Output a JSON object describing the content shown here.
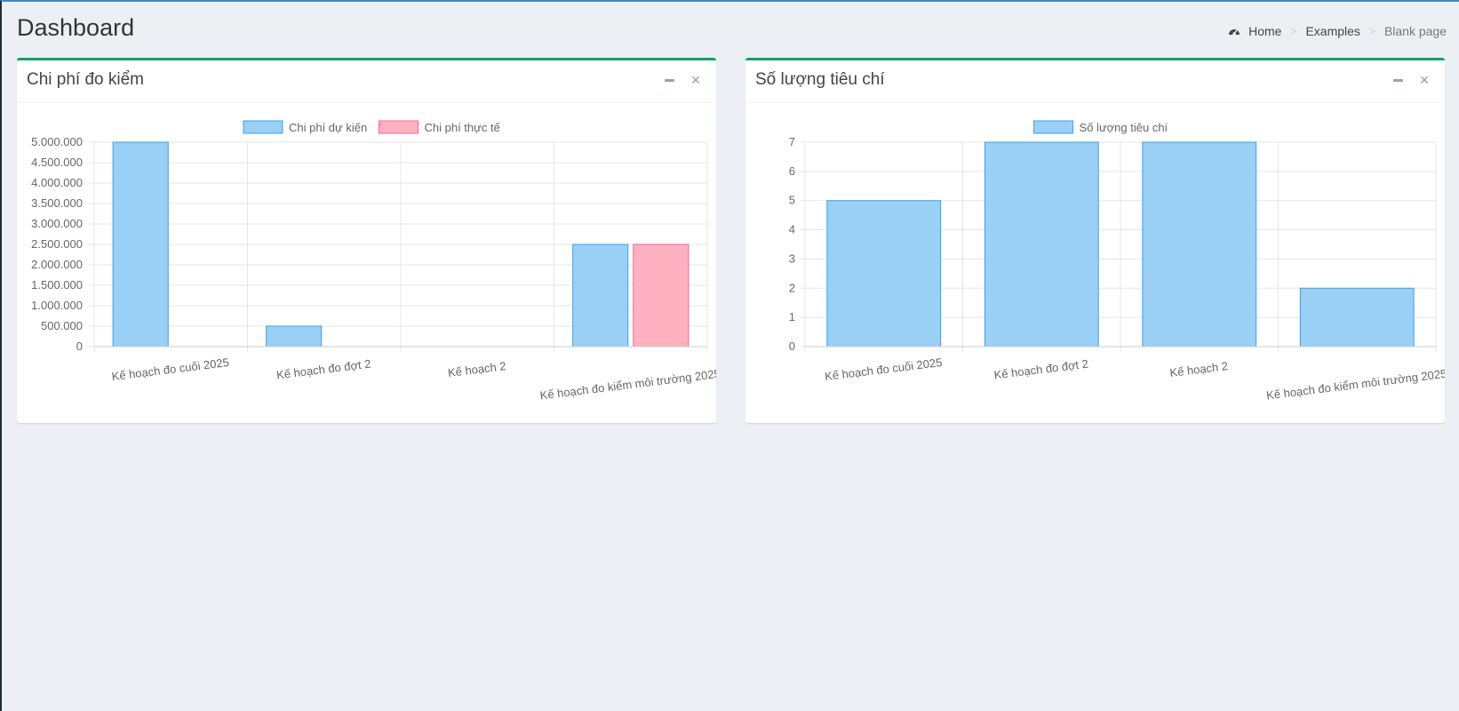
{
  "header": {
    "title": "Dashboard",
    "breadcrumb": [
      {
        "label": "Home",
        "icon": "dashboard-icon"
      },
      {
        "label": "Examples"
      },
      {
        "label": "Blank page"
      }
    ],
    "separator": ">"
  },
  "boxes": [
    {
      "title": "Chi phí đo kiểm",
      "accent": "#00a65a"
    },
    {
      "title": "Số lượng tiêu chí",
      "accent": "#00a65a"
    }
  ],
  "chart_data": [
    {
      "type": "bar",
      "title": "",
      "categories": [
        "Kế hoạch đo cuối 2025",
        "Kế hoạch đo đợt 2",
        "Kế hoạch 2",
        "Kế hoạch đo kiểm môi trường 2025"
      ],
      "series": [
        {
          "name": "Chi phí dự kiến",
          "values": [
            5000000,
            500000,
            0,
            2500000
          ],
          "fill": "#9ad0f5",
          "stroke": "#36a2eb"
        },
        {
          "name": "Chi phí thực tế",
          "values": [
            0,
            0,
            0,
            2500000
          ],
          "fill": "#ffb1c1",
          "stroke": "#ff6384"
        }
      ],
      "ylim": [
        0,
        5000000
      ],
      "yticks": [
        "0",
        "500.000",
        "1.000.000",
        "1.500.000",
        "2.000.000",
        "2.500.000",
        "3.000.000",
        "3.500.000",
        "4.000.000",
        "4.500.000",
        "5.000.000"
      ],
      "legend": "top",
      "grid": true
    },
    {
      "type": "bar",
      "title": "",
      "categories": [
        "Kế hoạch đo cuối 2025",
        "Kế hoạch đo đợt 2",
        "Kế hoạch 2",
        "Kế hoạch đo kiểm môi trường 2025"
      ],
      "series": [
        {
          "name": "Số lượng tiêu chí",
          "values": [
            5,
            7,
            7,
            2
          ],
          "fill": "#9ad0f5",
          "stroke": "#36a2eb"
        }
      ],
      "ylim": [
        0,
        7
      ],
      "yticks": [
        "0",
        "1",
        "2",
        "3",
        "4",
        "5",
        "6",
        "7"
      ],
      "legend": "top",
      "grid": true
    }
  ]
}
